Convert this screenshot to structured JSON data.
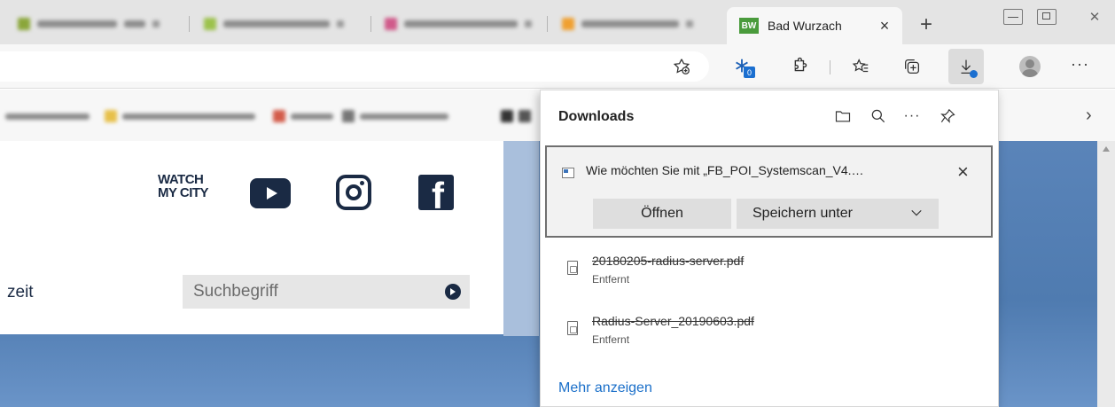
{
  "tabs": {
    "active_title": "Bad Wurzach",
    "active_favicon_text": "BW"
  },
  "page": {
    "watch_line1": "WATCH",
    "watch_line2": "MY CITY",
    "nav_fragment": "zeit",
    "search_placeholder": "Suchbegriff"
  },
  "downloads": {
    "title": "Downloads",
    "prompt": {
      "message": "Wie möchten Sie mit „FB_POI_Systemscan_V4.…",
      "open_label": "Öffnen",
      "save_as_label": "Speichern unter"
    },
    "items": [
      {
        "name": "20180205-radius-server.pdf",
        "status": "Entfernt"
      },
      {
        "name": "Radius-Server_20190603.pdf",
        "status": "Entfernt"
      }
    ],
    "show_more": "Mehr anzeigen"
  },
  "toolbar": {
    "extensions_badge": "0"
  },
  "colors": {
    "link_blue": "#1a6fc9",
    "page_navy": "#1a2a44",
    "page_background_blue": "#4f7bb0",
    "favicon_green": "#4a9b3c"
  },
  "icons": [
    "star-add-icon",
    "puzzle-extension-icon",
    "extension-icon",
    "favorites-icon",
    "collections-icon",
    "downloads-icon",
    "profile-icon",
    "more-icon",
    "folder-icon",
    "search-icon",
    "pin-icon",
    "close-icon",
    "chevron-down-icon",
    "chevron-right-icon",
    "youtube-icon",
    "instagram-icon",
    "facebook-icon",
    "pdf-file-icon"
  ]
}
